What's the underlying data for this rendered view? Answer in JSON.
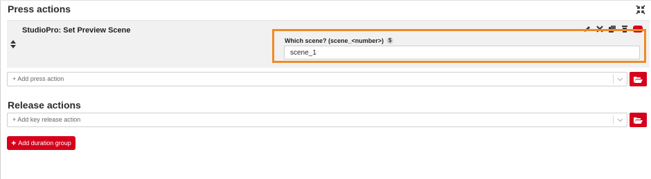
{
  "press_actions": {
    "title": "Press actions",
    "action": {
      "title": "StudioPro: Set Preview Scene",
      "field_label": "Which scene? (scene_<number>)",
      "field_badge": "$",
      "field_value": "scene_1"
    },
    "add_placeholder": "+ Add press action"
  },
  "release_actions": {
    "title": "Release actions",
    "add_placeholder": "+ Add key release action"
  },
  "add_duration_group": {
    "plus": "+",
    "label": "Add duration group"
  },
  "colors": {
    "accent": "#d6001c",
    "highlight": "#f08a24",
    "card_bg": "#f1f1f1"
  },
  "icons": [
    "collapse-icon",
    "drag-handle-icon",
    "edit-icon",
    "move-icon",
    "copy-icon",
    "delete-icon",
    "toggle-icon",
    "chevron-down-icon",
    "folder-open-icon"
  ]
}
